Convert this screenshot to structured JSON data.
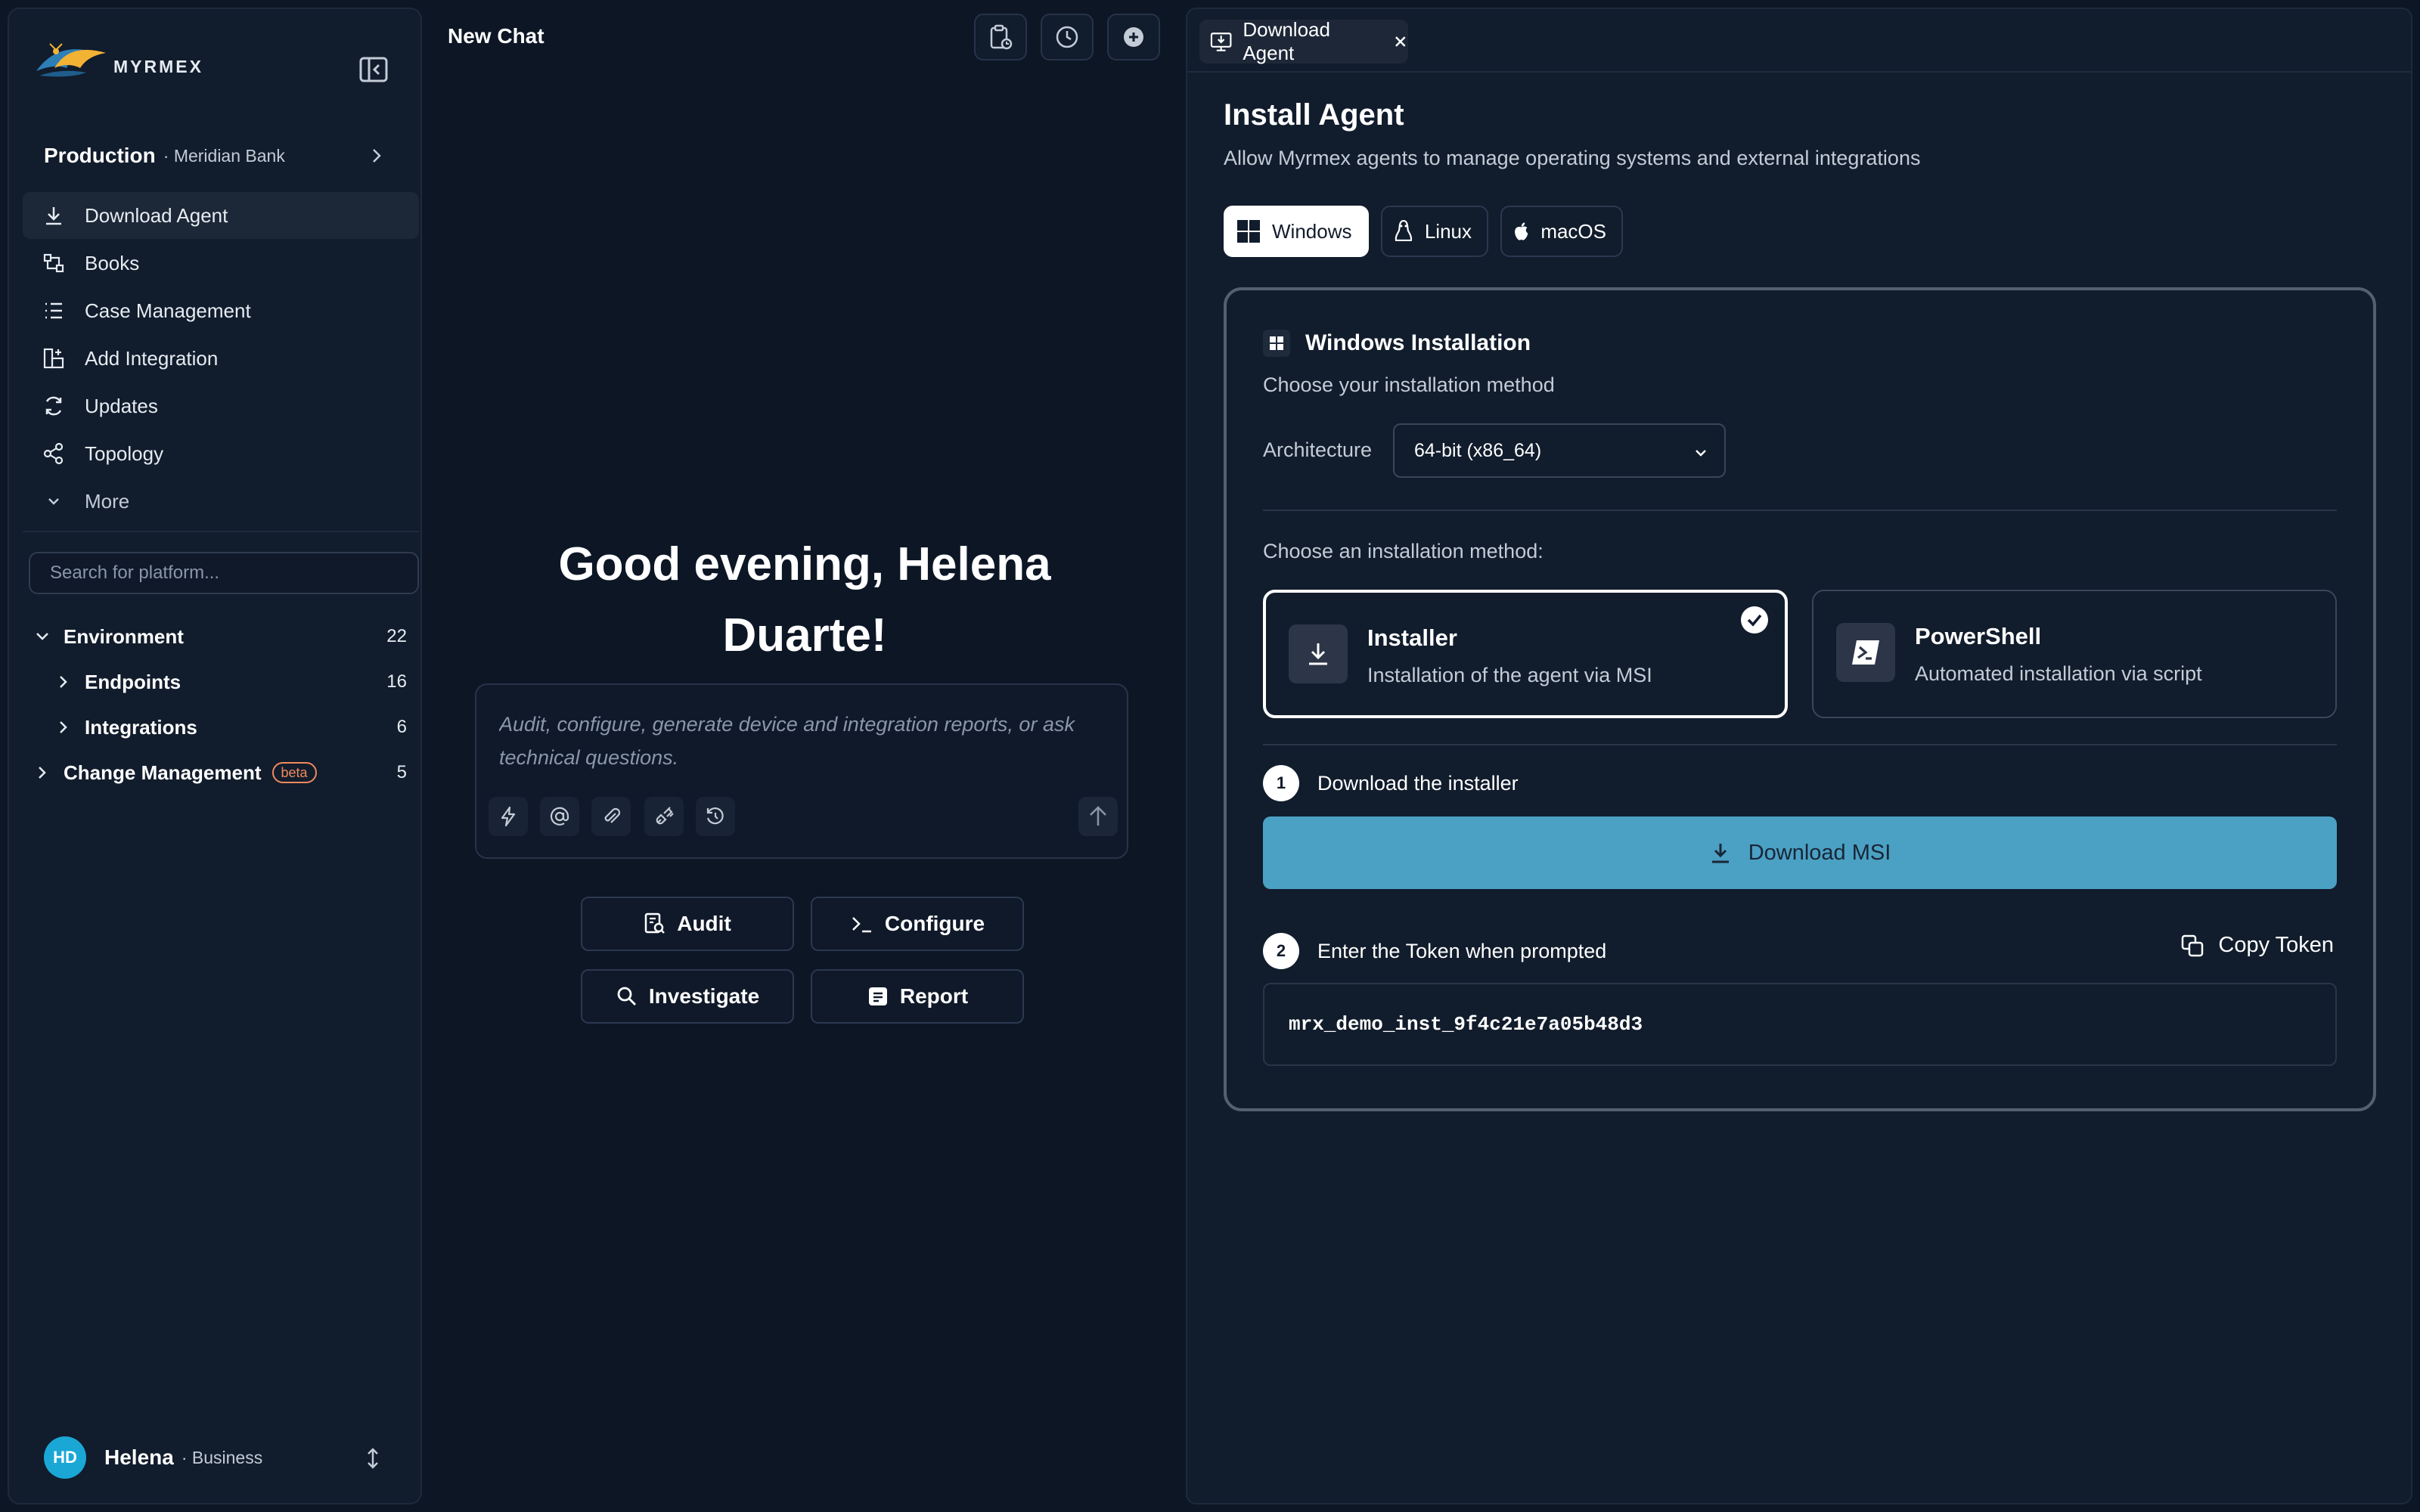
{
  "sidebar": {
    "logo_text": "MYRMEX",
    "org": {
      "name": "Production",
      "subtitle": "· Meridian Bank"
    },
    "nav": [
      {
        "label": "Download Agent",
        "icon": "download-icon",
        "active": true
      },
      {
        "label": "Books",
        "icon": "books-icon"
      },
      {
        "label": "Case Management",
        "icon": "list-icon"
      },
      {
        "label": "Add Integration",
        "icon": "add-integration-icon"
      },
      {
        "label": "Updates",
        "icon": "refresh-icon"
      },
      {
        "label": "Topology",
        "icon": "share-icon"
      },
      {
        "label": "More",
        "icon": "chevron-down-icon"
      }
    ],
    "search_placeholder": "Search for platform...",
    "tree": {
      "environment": {
        "label": "Environment",
        "count": "22"
      },
      "endpoints": {
        "label": "Endpoints",
        "count": "16"
      },
      "integrations": {
        "label": "Integrations",
        "count": "6"
      },
      "change_management": {
        "label": "Change Management",
        "badge": "beta",
        "count": "5"
      }
    },
    "user": {
      "initials": "HD",
      "name": "Helena",
      "plan": "· Business"
    }
  },
  "chat": {
    "title": "New Chat",
    "greeting_line1": "Good evening, Helena",
    "greeting_line2": "Duarte!",
    "composer_placeholder": "Audit, configure, generate device and integration reports, or ask technical questions.",
    "actions": {
      "audit": "Audit",
      "configure": "Configure",
      "investigate": "Investigate",
      "report": "Report"
    }
  },
  "panel": {
    "tab_label": "Download Agent",
    "title": "Install Agent",
    "subtitle": "Allow Myrmex agents to manage operating systems and external integrations",
    "os_tabs": {
      "windows": "Windows",
      "linux": "Linux",
      "macos": "macOS"
    },
    "selected_os": "Windows",
    "card": {
      "title": "Windows Installation",
      "subtitle": "Choose your installation method",
      "architecture_label": "Architecture",
      "architecture_value": "64-bit (x86_64)",
      "method_label": "Choose an installation method:",
      "methods": {
        "installer": {
          "title": "Installer",
          "desc": "Installation of the agent via MSI"
        },
        "powershell": {
          "title": "PowerShell",
          "desc": "Automated installation via script"
        }
      },
      "selected_method": "Installer",
      "step1": {
        "num": "1",
        "text": "Download the installer"
      },
      "download_button": "Download MSI",
      "step2": {
        "num": "2",
        "text": "Enter the Token when prompted"
      },
      "copy_button": "Copy Token",
      "token": "mrx_demo_inst_9f4c21e7a05b48d3"
    }
  },
  "colors": {
    "background": "#0c1625",
    "surface": "#111c2c",
    "accent": "#4aa1c4",
    "avatar": "#1aa7d6",
    "beta": "#f08a5d"
  }
}
